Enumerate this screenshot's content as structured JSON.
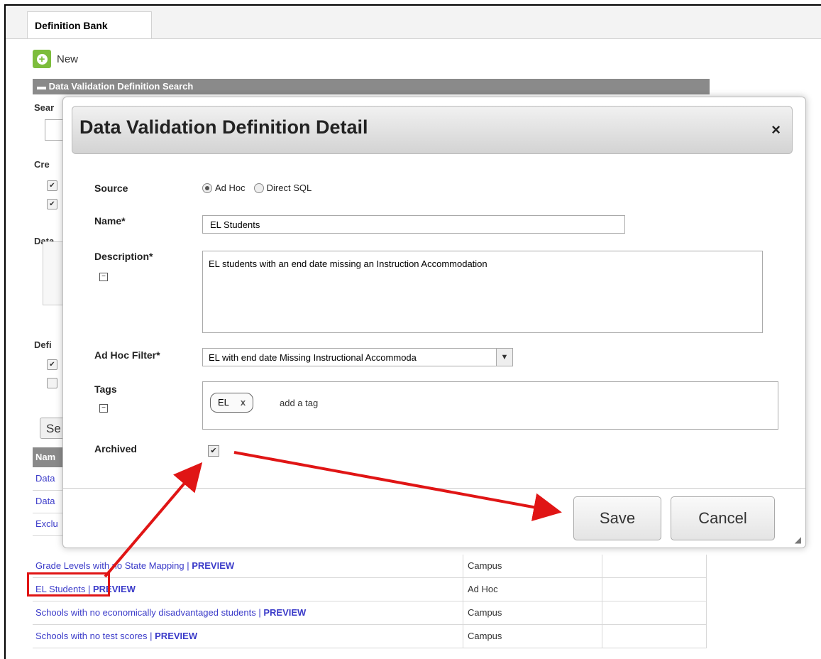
{
  "tab": {
    "label": "Definition Bank"
  },
  "toolbar": {
    "new_label": "New"
  },
  "search_panel": {
    "header": "Data Validation Definition Search",
    "search_label": "Sear",
    "created_label": "Cre",
    "data_label": "Data",
    "definition_label": "Defi",
    "search_button": "Se"
  },
  "table": {
    "header_name": "Nam",
    "rows": [
      {
        "name": "Data",
        "preview": "",
        "type": ""
      },
      {
        "name": "Data",
        "preview": "",
        "type": ""
      },
      {
        "name": "Exclu",
        "preview": "",
        "type": ""
      },
      {
        "name": "Grade Levels with no State Mapping",
        "preview": "PREVIEW",
        "type": "Campus"
      },
      {
        "name": "EL  Students",
        "preview": "PREVIEW",
        "type": "Ad Hoc"
      },
      {
        "name": "Schools with no economically disadvantaged students",
        "preview": "PREVIEW",
        "type": "Campus"
      },
      {
        "name": "Schools with no test scores",
        "preview": "PREVIEW",
        "type": "Campus"
      }
    ]
  },
  "modal": {
    "title": "Data Validation Definition Detail",
    "close": "×",
    "source_label": "Source",
    "source_options": [
      "Ad Hoc",
      "Direct SQL"
    ],
    "source_selected": "Ad Hoc",
    "name_label": "Name*",
    "name_value": "EL Students",
    "description_label": "Description*",
    "description_value": "EL  students with an end date missing an Instruction Accommodation",
    "filter_label": "Ad Hoc Filter*",
    "filter_value": "EL  with end date Missing Instructional Accommoda",
    "tags_label": "Tags",
    "tags": [
      {
        "label": "EL",
        "remove": "x"
      }
    ],
    "tag_placeholder": "add a tag",
    "archived_label": "Archived",
    "archived": true,
    "save_label": "Save",
    "cancel_label": "Cancel"
  },
  "colors": {
    "annotation": "#e01515",
    "link": "#3b3bc9",
    "new_icon": "#7dbd3c"
  }
}
